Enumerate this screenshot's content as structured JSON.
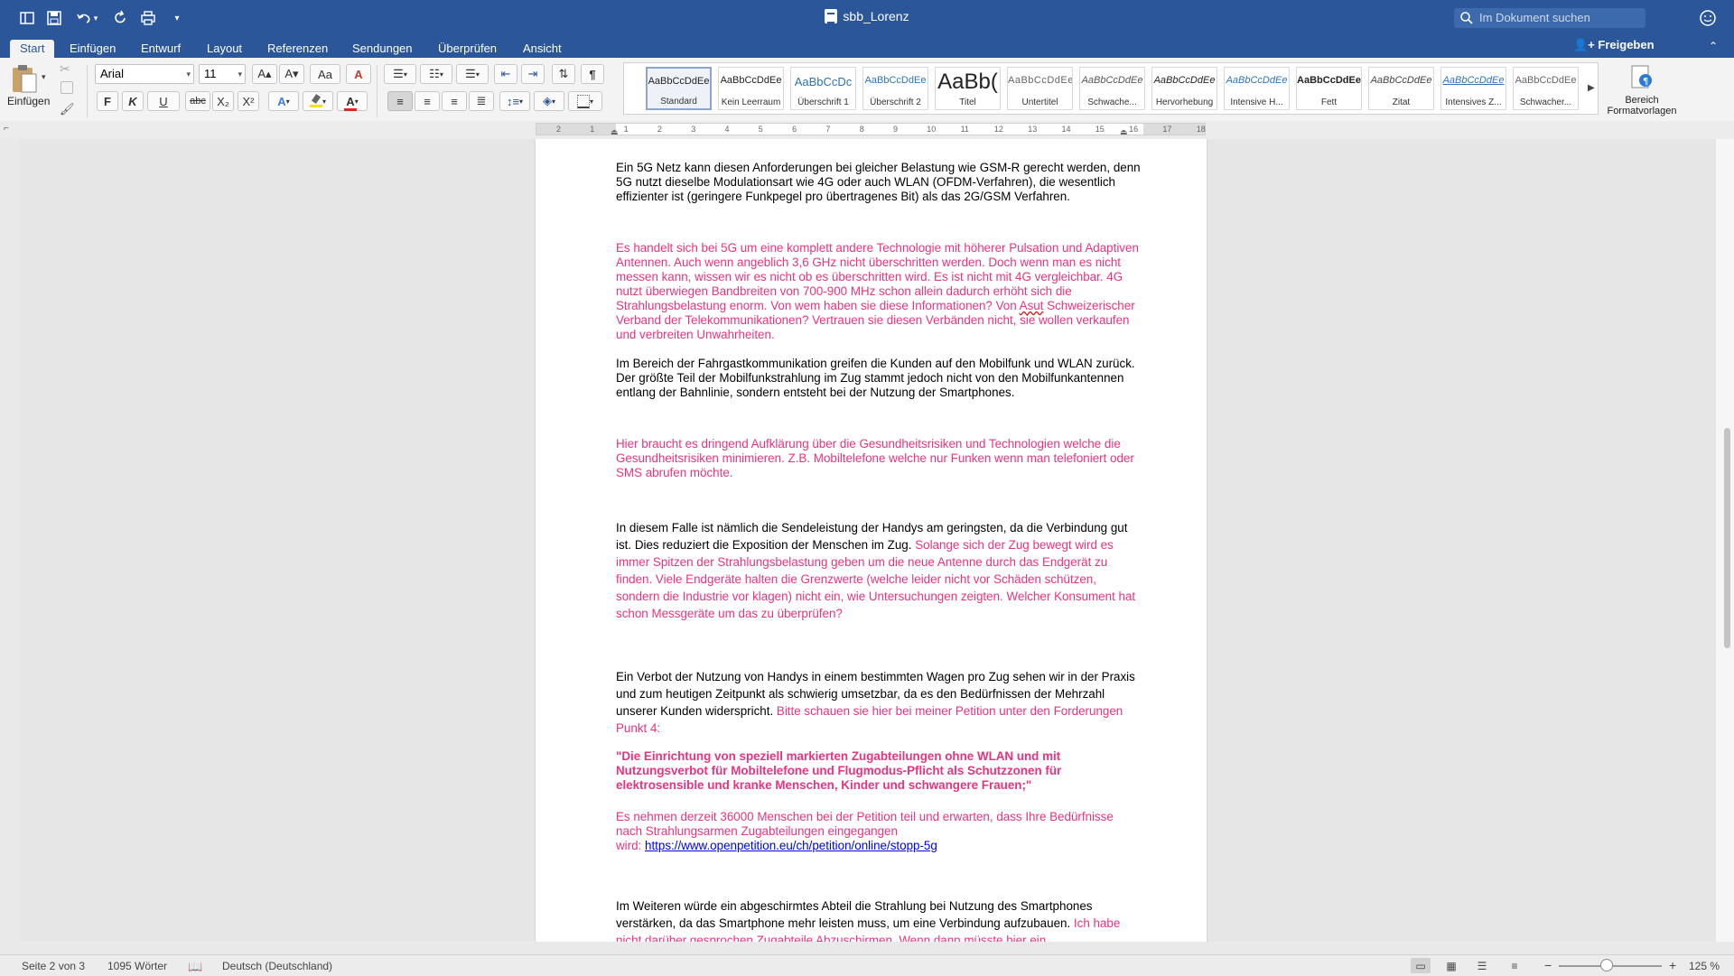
{
  "window": {
    "title": "sbb_Lorenz"
  },
  "search": {
    "placeholder": "Im Dokument suchen"
  },
  "share": {
    "label": "Freigeben"
  },
  "tabs": [
    "Start",
    "Einfügen",
    "Entwurf",
    "Layout",
    "Referenzen",
    "Sendungen",
    "Überprüfen",
    "Ansicht"
  ],
  "ribbon": {
    "paste_label": "Einfügen",
    "font_name": "Arial",
    "font_size": "11",
    "bold": "F",
    "italic": "K",
    "underline": "U",
    "strike": "abc",
    "subscript": "X₂",
    "superscript": "X²",
    "grow": "A▴",
    "shrink": "A▾",
    "case": "Aa",
    "pilcrow": "¶",
    "highlight_color": "#f5e400",
    "font_color": "#e2251d",
    "bereich_label": "Bereich Formatvorlagen"
  },
  "styles": [
    {
      "preview": "AaBbCcDdEe",
      "name": "Standard"
    },
    {
      "preview": "AaBbCcDdEe",
      "name": "Kein Leerraum"
    },
    {
      "preview": "AaBbCcDc",
      "name": "Überschrift 1"
    },
    {
      "preview": "AaBbCcDdEe",
      "name": "Überschrift 2"
    },
    {
      "preview": "AaBb(",
      "name": "Titel"
    },
    {
      "preview": "AaBbCcDdEe",
      "name": "Untertitel"
    },
    {
      "preview": "AaBbCcDdEe",
      "name": "Schwache..."
    },
    {
      "preview": "AaBbCcDdEe",
      "name": "Hervorhebung"
    },
    {
      "preview": "AaBbCcDdEe",
      "name": "Intensive H..."
    },
    {
      "preview": "AaBbCcDdEe",
      "name": "Fett"
    },
    {
      "preview": "AaBbCcDdEe",
      "name": "Zitat"
    },
    {
      "preview": "AaBbCcDdEe",
      "name": "Intensives Z..."
    },
    {
      "preview": "AaBbCcDdEe",
      "name": "Schwacher..."
    }
  ],
  "ruler": {
    "labels": [
      "2",
      "1",
      "1",
      "2",
      "3",
      "4",
      "5",
      "6",
      "7",
      "8",
      "9",
      "10",
      "11",
      "12",
      "13",
      "14",
      "15",
      "16",
      "17",
      "18"
    ]
  },
  "document": {
    "p1": " Ein 5G Netz kann diesen Anforderungen bei gleicher Belastung wie GSM-R gerecht werden, denn 5G nutzt dieselbe Modulationsart wie 4G oder auch WLAN (OFDM-Verfahren), die wesentlich effizienter ist (geringere Funkpegel pro übertragenes Bit) als das 2G/GSM Verfahren.",
    "p2a": "Es handelt sich bei 5G um eine komplett andere Technologie mit höherer Pulsation und Adaptiven Antennen. Auch wenn angeblich 3,6 GHz nicht überschritten werden. Doch wenn man es nicht messen kann, wissen wir es nicht ob es überschritten wird. Es ist nicht mit 4G vergleichbar. 4G nutzt überwiegen Bandbreiten von 700-900 MHz schon allein dadurch erhöht sich die Strahlungsbelastung enorm. Von wem haben sie diese Informationen? Von ",
    "p2b": "Asut",
    "p2c": " Schweizerischer Verband der Telekommunikationen? Vertrauen sie diesen Verbänden nicht, sie wollen verkaufen und verbreiten Unwahrheiten.",
    "p3": " Im Bereich der Fahrgastkommunikation greifen die Kunden auf den Mobilfunk und WLAN zurück. Der größte Teil der Mobilfunkstrahlung im Zug stammt jedoch nicht von den Mobilfunkantennen entlang der Bahnlinie, sondern entsteht bei der Nutzung der Smartphones.",
    "p4": "Hier braucht es dringend Aufklärung über die Gesundheitsrisiken und Technologien welche die Gesundheitsrisiken minimieren. Z.B. Mobiltelefone welche nur Funken wenn man telefoniert oder SMS abrufen möchte.",
    "p5a": "In diesem Falle ist nämlich die Sendeleistung der Handys am geringsten, da die Verbindung gut ist. Dies reduziert die Exposition der Menschen im Zug. ",
    "p5b": "Solange sich der Zug bewegt wird es immer Spitzen der Strahlungsbelastung geben um die neue Antenne durch das Endgerät zu finden. Viele Endgeräte halten die Grenzwerte (welche leider nicht vor Schäden schützen, sondern die Industrie vor klagen) nicht ein, wie Untersuchungen zeigten. Welcher Konsument hat schon Messgeräte um das zu überprüfen?",
    "p6a": "Ein Verbot der Nutzung von Handys in einem bestimmten Wagen pro Zug sehen wir in der Praxis und zum heutigen Zeitpunkt als schwierig umsetzbar, da es den Bedürfnissen der Mehrzahl unserer Kunden widerspricht. ",
    "p6b": "Bitte schauen sie hier bei meiner Petition unter den Forderungen Punkt 4:",
    "p7": "\"Die Einrichtung von speziell markierten Zugabteilungen ohne WLAN und mit Nutzungsverbot für Mobiltelefone und Flugmodus-Pflicht als Schutzzonen für elektrosensible und kranke Menschen, Kinder und schwangere Frauen;\"",
    "p8a": "Es nehmen derzeit 36000 Menschen bei der Petition teil und erwarten, dass Ihre Bedürfnisse nach Strahlungsarmen Zugabteilungen eingegangen",
    "p8b": "wird: ",
    "p8link": "https://www.openpetition.eu/ch/petition/online/stopp-5g",
    "p9a": "Im Weiteren würde ein abgeschirmtes Abteil die Strahlung bei Nutzung des Smartphones verstärken, da das Smartphone mehr leisten muss, um eine Verbindung aufzubauen. ",
    "p9b": "Ich habe nicht darüber gesprochen Zugabteile Abzuschirmen. Wenn dann müsste hier ein"
  },
  "status": {
    "page": "Seite 2 von 3",
    "words": "1095 Wörter",
    "language": "Deutsch (Deutschland)",
    "zoom": "125 %",
    "zoom_minus": "−",
    "zoom_plus": "+"
  }
}
